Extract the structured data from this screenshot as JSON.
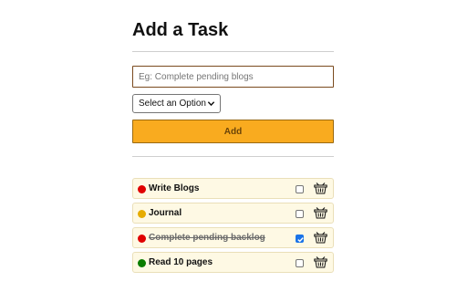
{
  "form": {
    "title": "Add a Task",
    "input_placeholder": "Eg: Complete pending blogs",
    "input_value": "",
    "select_label": "Select an Option",
    "add_label": "Add"
  },
  "tasks": [
    {
      "label": "Write Blogs",
      "priority_color": "#e00000",
      "done": false
    },
    {
      "label": "Journal",
      "priority_color": "#e6ac00",
      "done": false
    },
    {
      "label": "Complete pending backlog",
      "priority_color": "#e00000",
      "done": true
    },
    {
      "label": "Read 10 pages",
      "priority_color": "#0a7d00",
      "done": false
    }
  ],
  "icons": {
    "delete": "trash-basket-icon",
    "dropdown": "chevron-down-icon"
  },
  "colors": {
    "accent": "#f9ab1f",
    "task_bg": "#fef9e4",
    "input_border": "#7a4a1e"
  }
}
